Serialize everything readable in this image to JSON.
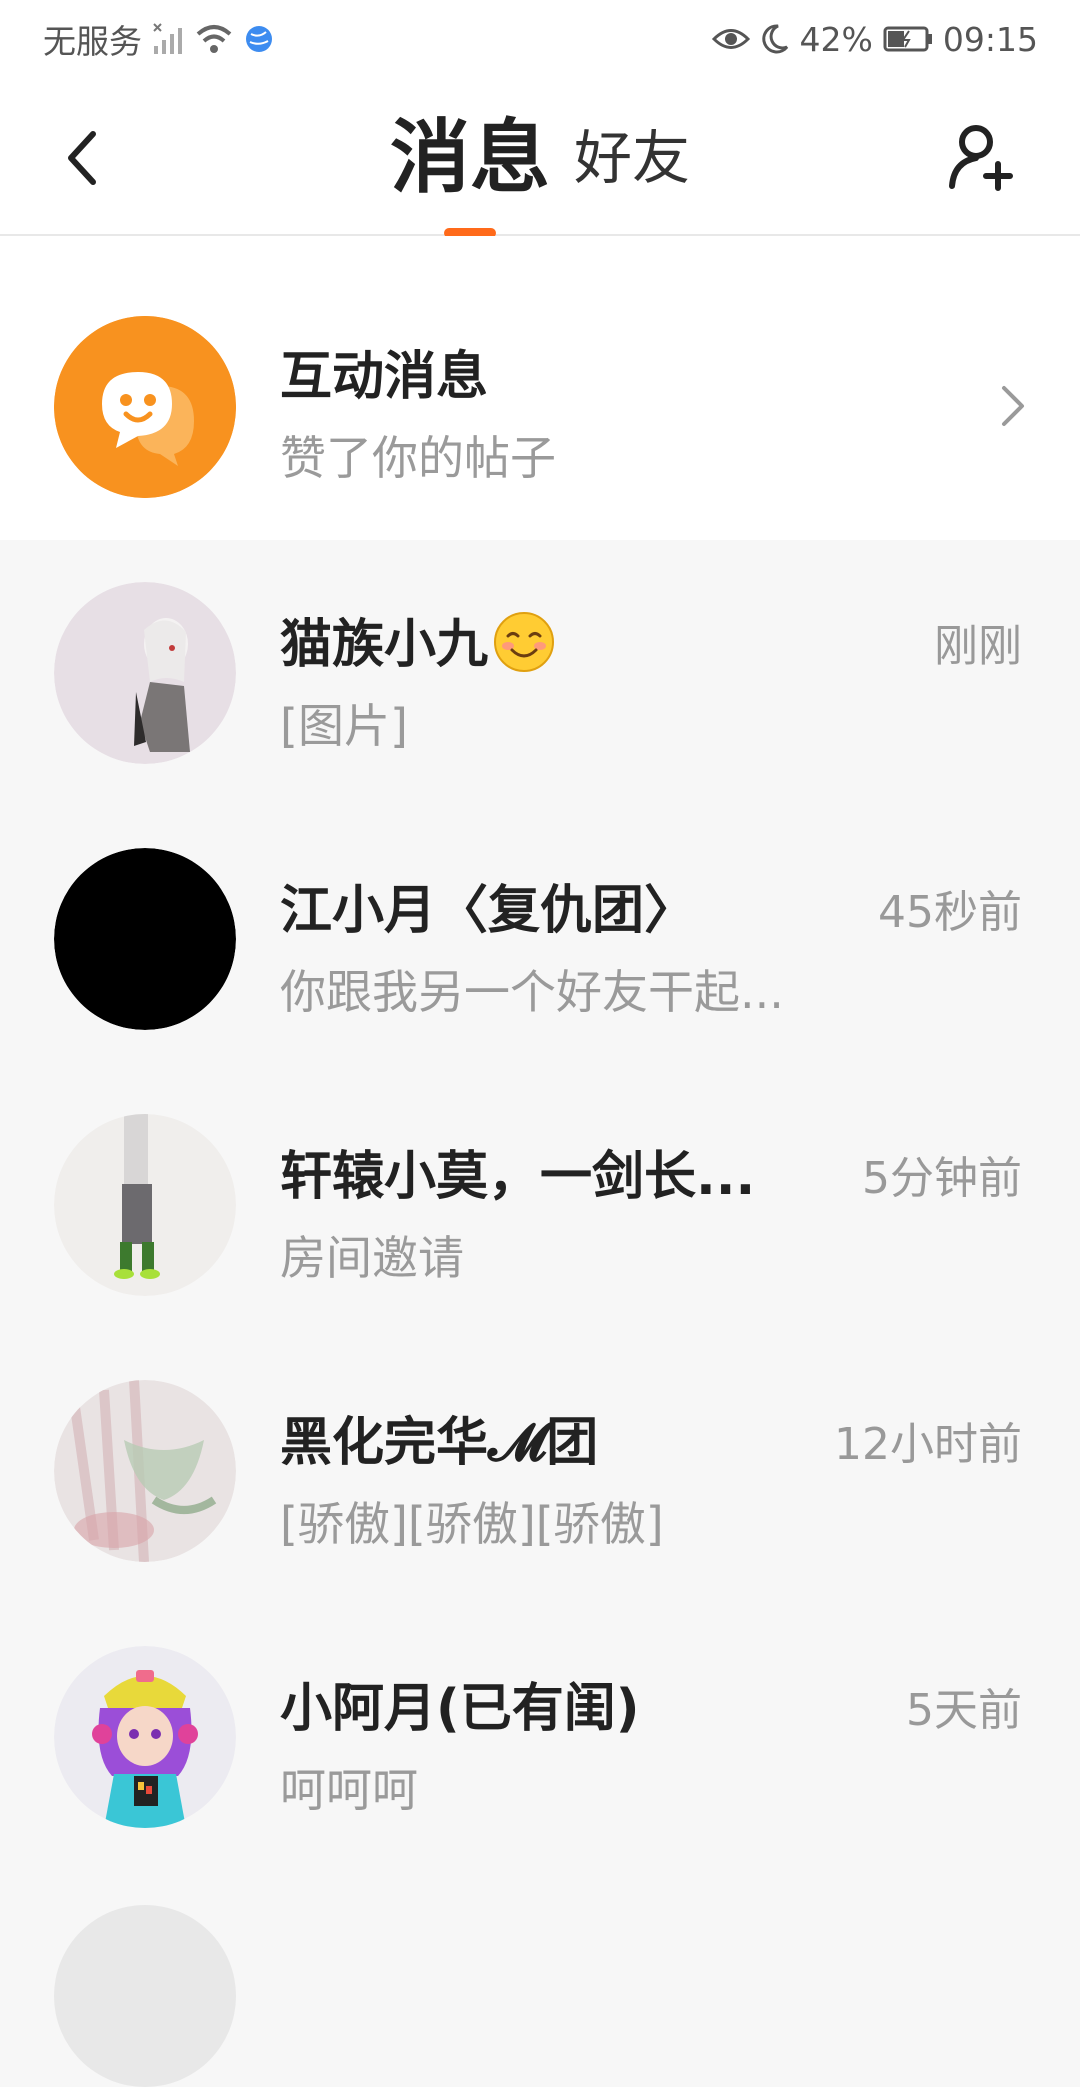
{
  "status_bar": {
    "carrier": "无服务",
    "battery": "42%",
    "time": "09:15"
  },
  "nav": {
    "tabs": [
      {
        "label": "消息",
        "active": true
      },
      {
        "label": "好友",
        "active": false
      }
    ],
    "accent_color": "#ff6a1a"
  },
  "interaction": {
    "title": "互动消息",
    "subtitle": "赞了你的帖子"
  },
  "chats": [
    {
      "name": "猫族小九",
      "preview": "[图片]",
      "time": "刚刚",
      "avatar": "anime-girl-avatar"
    },
    {
      "name": "江小月〈复仇团〉",
      "preview": "你跟我另一个好友干起...",
      "time": "45秒前",
      "avatar": "black-avatar"
    },
    {
      "name": "轩辕小莫，一剑长...",
      "preview": "房间邀请",
      "time": "5分钟前",
      "avatar": "character-avatar"
    },
    {
      "name": "黑化完华𝓜团",
      "preview": "[骄傲][骄傲][骄傲]",
      "time": "12小时前",
      "avatar": "faded-scene-avatar"
    },
    {
      "name": "小阿月(已有闺)",
      "preview": "呵呵呵",
      "time": "5天前",
      "avatar": "purple-hair-girl-avatar"
    }
  ]
}
